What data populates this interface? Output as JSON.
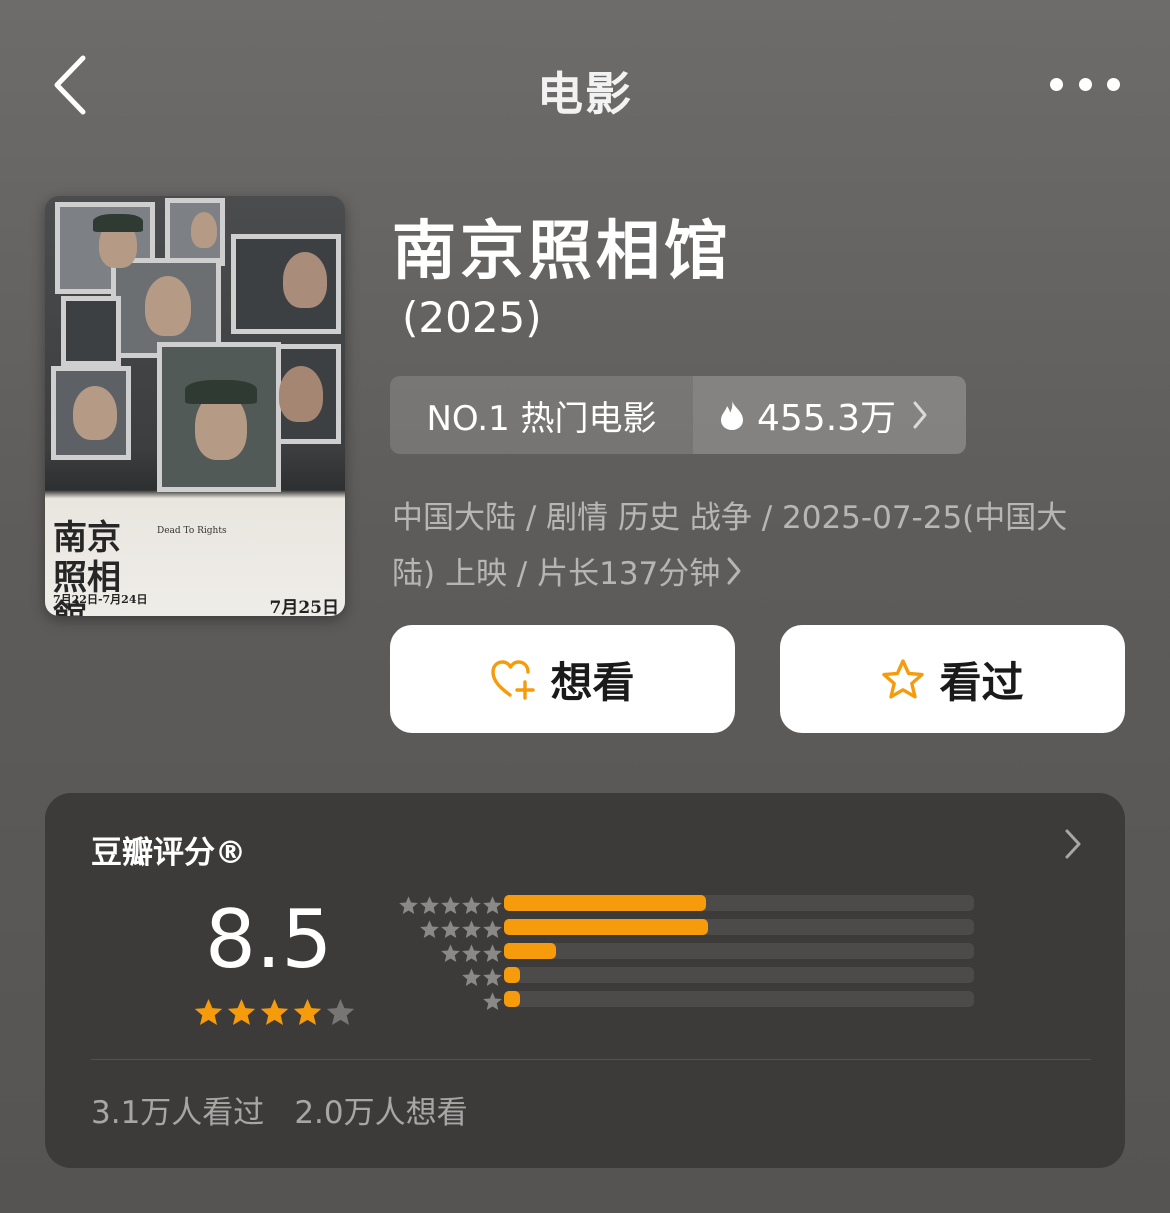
{
  "nav": {
    "title": "电影"
  },
  "movie": {
    "title": "南京照相馆",
    "year": "(2025)",
    "poster": {
      "title": "南京照相館",
      "subtitle": "Dead To Rights",
      "dates": "7月22日-7月24日",
      "release": "7月25日"
    }
  },
  "rank": {
    "label": "NO.1 热门电影",
    "heat": "455.3万"
  },
  "meta": {
    "line1": "中国大陆 / 剧情 历史 战争 / 2025-07-25(中国大",
    "line2": "陆) 上映 / 片长137分钟"
  },
  "actions": {
    "want_label": "想看",
    "seen_label": "看过"
  },
  "rating": {
    "label": "豆瓣评分®",
    "score": "8.5",
    "stars": 4.0,
    "distribution": [
      {
        "stars": 5,
        "fraction": 0.43
      },
      {
        "stars": 4,
        "fraction": 0.435
      },
      {
        "stars": 3,
        "fraction": 0.11
      },
      {
        "stars": 2,
        "fraction": 0.035
      },
      {
        "stars": 1,
        "fraction": 0.035
      }
    ],
    "seen_count": "3.1万人看过",
    "want_count": "2.0万人想看"
  },
  "colors": {
    "accent": "#f59b0c",
    "background": "#5e5c5a",
    "card": "#3c3b3a"
  }
}
